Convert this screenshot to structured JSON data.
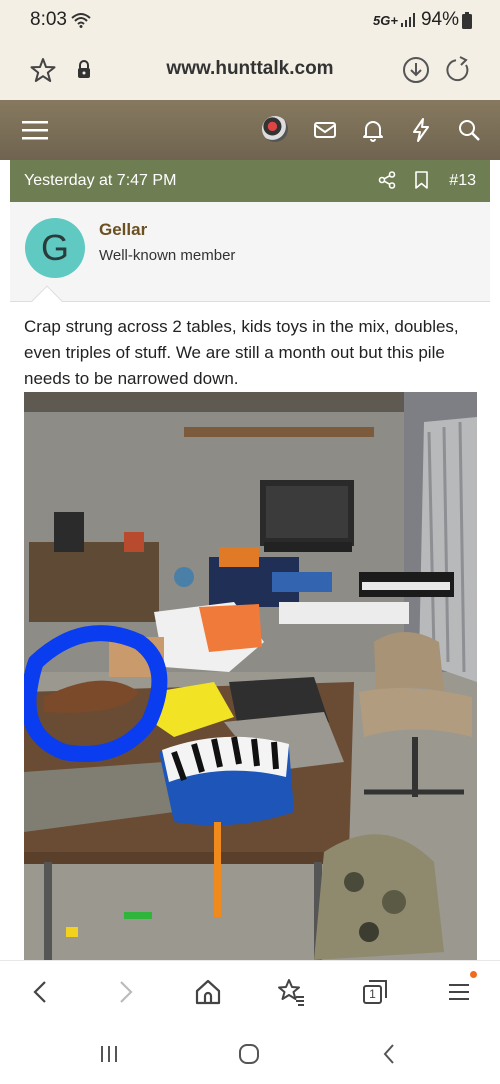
{
  "status_bar": {
    "time": "8:03",
    "network": "5G+",
    "battery": "94%"
  },
  "url_bar": {
    "url": "www.hunttalk.com"
  },
  "post": {
    "date": "Yesterday at 7:47 PM",
    "number": "#13",
    "author": {
      "initial": "G",
      "name": "Gellar",
      "title": "Well-known member"
    },
    "body": "Crap strung across 2 tables, kids toys in the mix, doubles, even triples of stuff. We are still a month out but this pile needs to be narrowed down."
  },
  "bottom_nav": {
    "tab_count": "1"
  },
  "colors": {
    "header": "#7a6e58",
    "post_strip": "#6e7d52",
    "avatar": "#5fc9c2",
    "author_name": "#6b5021",
    "notification_dot": "#f26b1d",
    "circle_annotation": "#0a3cf0"
  },
  "icons": [
    "wifi-icon",
    "signal-icon",
    "battery-icon",
    "star-icon",
    "lock-icon",
    "download-icon",
    "reload-icon",
    "hamburger-icon",
    "mail-icon",
    "bell-icon",
    "lightning-icon",
    "search-icon",
    "share-icon",
    "bookmark-icon",
    "back-icon",
    "forward-icon",
    "home-icon",
    "bookmarks-icon",
    "tabs-icon",
    "menu-icon",
    "recents-icon",
    "home-circle-icon",
    "system-back-icon"
  ]
}
